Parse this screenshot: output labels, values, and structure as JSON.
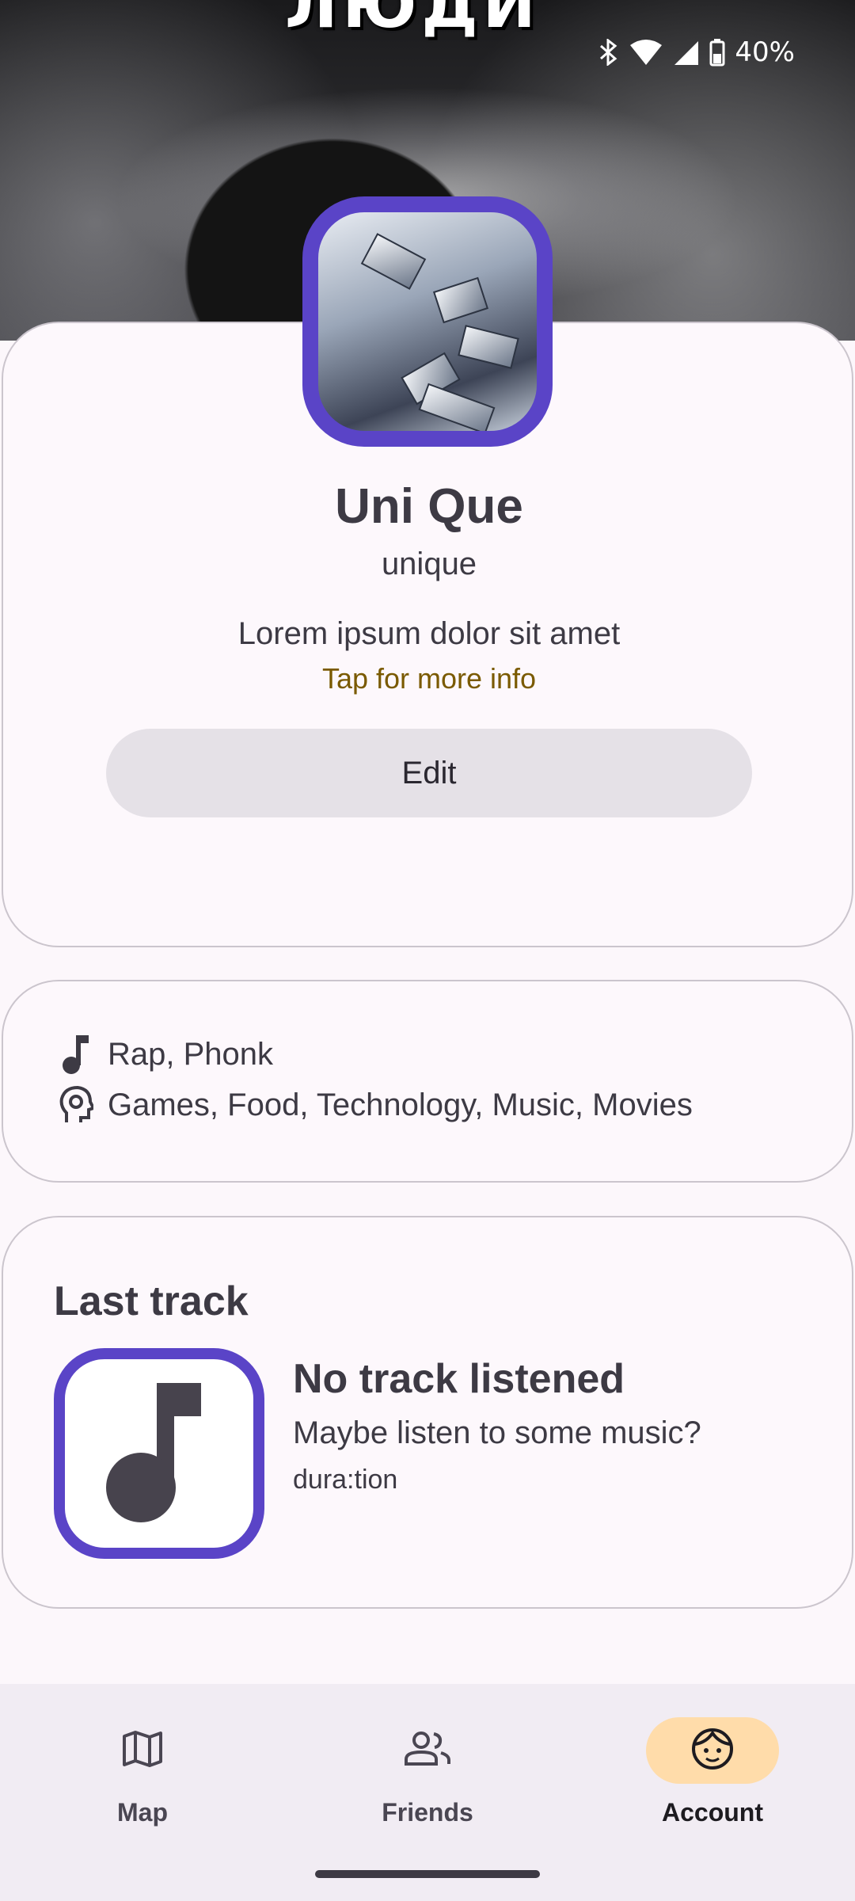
{
  "banner": {
    "text": "ЛЮДИ"
  },
  "status_bar": {
    "battery": "40%"
  },
  "profile": {
    "name": "Uni Que",
    "username": "unique",
    "bio": "Lorem ipsum dolor sit amet",
    "more_info": "Tap for more info",
    "edit_label": "Edit"
  },
  "interests": {
    "music": "Rap, Phonk",
    "hobbies": "Games, Food, Technology, Music, Movies"
  },
  "last_track": {
    "title": "Last track",
    "name": "No track listened",
    "subtitle": "Maybe listen to some music?",
    "duration": "dura:tion"
  },
  "nav": {
    "items": [
      {
        "label": "Map",
        "icon": "map-icon"
      },
      {
        "label": "Friends",
        "icon": "people-icon"
      },
      {
        "label": "Account",
        "icon": "face-icon"
      }
    ],
    "active": "Account"
  },
  "colors": {
    "accent": "#5a44c7",
    "link": "#7a5a00",
    "active_nav": "#ffdcaa"
  }
}
